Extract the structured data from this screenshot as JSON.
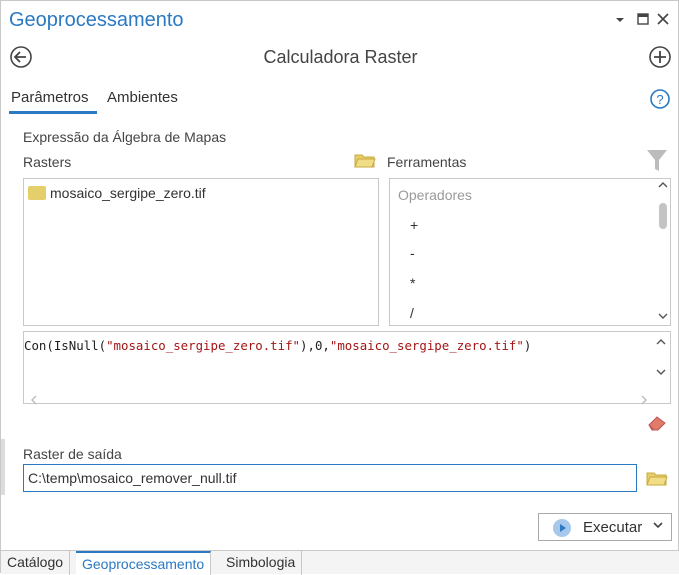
{
  "window": {
    "title": "Geoprocessamento",
    "controls": [
      "chevron-down",
      "maximize",
      "close"
    ]
  },
  "header": {
    "tool_title": "Calculadora Raster"
  },
  "tabs": {
    "parametros": "Parâmetros",
    "ambientes": "Ambientes"
  },
  "section_label": "Expressão da Álgebra de Mapas",
  "rasters": {
    "label": "Rasters",
    "items": [
      "mosaico_sergipe_zero.tif"
    ]
  },
  "ferramentas": {
    "label": "Ferramentas",
    "group": "Operadores",
    "items": [
      "+",
      "-",
      "*",
      "/"
    ]
  },
  "expression": {
    "prefix": "Con(IsNull(",
    "arg1": "\"mosaico_sergipe_zero.tif\"",
    "mid": "),0,",
    "arg2": "\"mosaico_sergipe_zero.tif\"",
    "suffix": ")"
  },
  "output": {
    "label": "Raster de saída",
    "value": "C:\\temp\\mosaico_remover_null.tif"
  },
  "run_button": {
    "label": "Executar"
  },
  "bottom_tabs": [
    "Catálogo",
    "Geoprocessamento",
    "Simbologia"
  ],
  "colors": {
    "accent": "#2b79c2",
    "string": "#a31515",
    "folder": "#e5cf6a"
  }
}
